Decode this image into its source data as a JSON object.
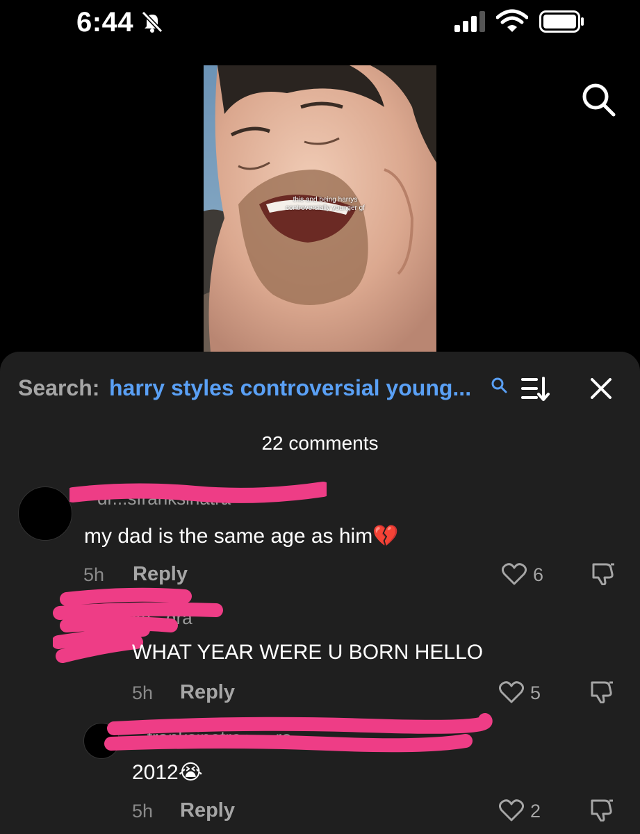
{
  "status_bar": {
    "time": "6:44",
    "icons": [
      "bell-slash-icon",
      "cellular-signal-icon",
      "wifi-icon",
      "battery-icon"
    ]
  },
  "video": {
    "overlay_caption": "this and being harrys controversially younger gf"
  },
  "top_search_icon": "search-icon",
  "comments_sheet": {
    "search_label": "Search:",
    "search_query": "harry styles controversial young...",
    "count_label": "22 comments",
    "comments": [
      {
        "username": "dr...sfranksinatra",
        "text": "my dad is the same age as him",
        "emoji": "💔",
        "time": "5h",
        "reply_label": "Reply",
        "likes": "6"
      },
      {
        "username": "ka...dra",
        "text": "WHAT YEAR WERE U BORN HELLO",
        "time": "5h",
        "reply_label": "Reply",
        "likes": "5"
      },
      {
        "username": "...franksinatra ▸ ...ra",
        "text": "2012",
        "emoji": "😭",
        "time": "5h",
        "reply_label": "Reply",
        "likes": "2"
      }
    ]
  },
  "colors": {
    "background": "#000000",
    "sheet": "#1f1f1f",
    "accent_link": "#5aa0f5",
    "redaction": "#ee3d86"
  }
}
